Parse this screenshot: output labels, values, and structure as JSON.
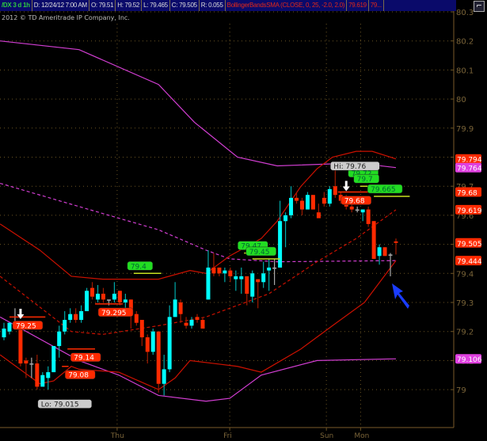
{
  "header": {
    "symbol": "/DX 3 d 1h",
    "date": "D: 12/24/12 7:00 AM",
    "open": "O: 79.51",
    "high": "H: 79.52",
    "low": "L: 79.465",
    "close": "C: 79.505",
    "range": "R: 0.055",
    "study": "BollingerBandsSMA (CLOSE, 0, 25, -2.0, 2.0)",
    "study_value1": "79.619",
    "study_value2": "79..."
  },
  "copyright": "2012 © TD Ameritrade IP Company, Inc.",
  "colors": {
    "up": "#00ffff",
    "down": "#ff2a00",
    "doji": "#aaaaaa",
    "band": "#cc1100",
    "magenta": "#d23ed2",
    "grid": "#6b5423",
    "label_green": "#22dd22",
    "arrow": "#1a3cff"
  },
  "chart_data": {
    "type": "candlestick",
    "title": "/DX 3 d 1h",
    "ylim": [
      79.0,
      80.3
    ],
    "yticks": [
      "80.3",
      "80.2",
      "80.1",
      "80",
      "79.9",
      "79.8",
      "79.7",
      "79.6",
      "79.5",
      "79.4",
      "79.3",
      "79.2",
      "79.1",
      "79"
    ],
    "xticks": [
      {
        "label": "Thu",
        "i": 20.5
      },
      {
        "label": "Fri",
        "i": 40.9
      },
      {
        "label": "Sun",
        "i": 58.4
      },
      {
        "label": "Mon",
        "i": 64.6
      }
    ],
    "candles": [
      [
        79.18,
        79.23,
        79.17,
        79.21
      ],
      [
        79.2,
        79.23,
        79.19,
        79.23
      ],
      [
        79.23,
        79.28,
        79.23,
        79.23
      ],
      [
        79.23,
        79.23,
        79.08,
        79.09
      ],
      [
        79.1,
        79.11,
        79.04,
        79.09
      ],
      [
        79.09,
        79.11,
        79.04,
        79.09
      ],
      [
        79.09,
        79.12,
        79.0,
        79.01
      ],
      [
        79.01,
        79.06,
        79.015,
        79.05
      ],
      [
        79.04,
        79.08,
        79.0,
        79.06
      ],
      [
        79.06,
        79.15,
        79.06,
        79.15
      ],
      [
        79.15,
        79.22,
        79.11,
        79.2
      ],
      [
        79.2,
        79.27,
        79.19,
        79.24
      ],
      [
        79.24,
        79.28,
        79.23,
        79.26
      ],
      [
        79.26,
        79.28,
        79.23,
        79.24
      ],
      [
        79.24,
        79.29,
        79.23,
        79.27
      ],
      [
        79.27,
        79.35,
        79.27,
        79.34
      ],
      [
        79.35,
        79.37,
        79.31,
        79.32
      ],
      [
        79.31,
        79.36,
        79.3,
        79.33
      ],
      [
        79.33,
        79.35,
        79.3,
        79.31
      ],
      [
        79.31,
        79.31,
        79.29,
        79.31
      ],
      [
        79.31,
        79.37,
        79.3,
        79.33
      ],
      [
        79.34,
        79.34,
        79.29,
        79.3
      ],
      [
        79.3,
        79.33,
        79.27,
        79.31
      ],
      [
        79.31,
        79.31,
        79.21,
        79.26
      ],
      [
        79.26,
        79.27,
        79.22,
        79.23
      ],
      [
        79.24,
        79.24,
        79.15,
        79.18
      ],
      [
        79.18,
        79.19,
        79.09,
        79.13
      ],
      [
        79.13,
        79.21,
        79.12,
        79.2
      ],
      [
        79.2,
        79.2,
        78.99,
        79.02
      ],
      [
        79.02,
        79.12,
        78.98,
        79.07
      ],
      [
        79.07,
        79.29,
        79.06,
        79.25
      ],
      [
        79.25,
        79.37,
        79.25,
        79.31
      ],
      [
        79.3,
        79.31,
        79.23,
        79.26
      ],
      [
        79.23,
        79.25,
        79.21,
        79.22
      ],
      [
        79.22,
        79.25,
        79.21,
        79.24
      ],
      [
        79.25,
        79.26,
        79.23,
        79.24
      ],
      [
        79.24,
        79.25,
        79.21,
        79.21
      ],
      [
        79.31,
        79.48,
        79.31,
        79.42
      ],
      [
        79.42,
        79.47,
        79.39,
        79.4
      ],
      [
        79.42,
        79.42,
        79.39,
        79.4
      ],
      [
        79.4,
        79.42,
        79.37,
        79.41
      ],
      [
        79.41,
        79.42,
        79.37,
        79.39
      ],
      [
        79.38,
        79.41,
        79.34,
        79.39
      ],
      [
        79.38,
        79.42,
        79.33,
        79.39
      ],
      [
        79.39,
        79.39,
        79.29,
        79.33
      ],
      [
        79.32,
        79.41,
        79.3,
        79.4
      ],
      [
        79.38,
        79.38,
        79.28,
        79.37
      ],
      [
        79.37,
        79.44,
        79.35,
        79.4
      ],
      [
        79.41,
        79.45,
        79.34,
        79.42
      ],
      [
        79.42,
        79.45,
        79.36,
        79.42
      ],
      [
        79.42,
        79.65,
        79.42,
        79.58
      ],
      [
        79.58,
        79.61,
        79.49,
        79.6
      ],
      [
        79.6,
        79.7,
        79.59,
        79.66
      ],
      [
        79.66,
        79.68,
        79.64,
        79.65
      ],
      [
        79.65,
        79.66,
        79.6,
        79.62
      ],
      [
        79.62,
        79.68,
        79.62,
        79.67
      ],
      [
        79.67,
        79.67,
        79.62,
        79.62
      ],
      [
        79.61,
        79.64,
        79.59,
        79.59
      ],
      [
        79.66,
        79.68,
        79.63,
        79.64
      ],
      [
        79.64,
        79.7,
        79.63,
        79.69
      ],
      [
        79.7,
        79.76,
        79.66,
        79.67
      ],
      [
        79.67,
        79.68,
        79.64,
        79.65
      ],
      [
        79.65,
        79.67,
        79.62,
        79.63
      ],
      [
        79.63,
        79.64,
        79.61,
        79.62
      ],
      [
        79.62,
        79.63,
        79.61,
        79.62
      ],
      [
        79.61,
        79.62,
        79.58,
        79.62
      ],
      [
        79.62,
        79.63,
        79.56,
        79.57
      ],
      [
        79.58,
        79.58,
        79.45,
        79.45
      ],
      [
        79.46,
        79.5,
        79.43,
        79.49
      ],
      [
        79.49,
        79.49,
        79.46,
        79.46
      ],
      [
        79.465,
        79.47,
        79.39,
        79.465
      ],
      [
        79.51,
        79.52,
        79.465,
        79.505
      ]
    ],
    "bands": {
      "upper": [
        [
          -0.7,
          79.57
        ],
        [
          6.5,
          79.48
        ],
        [
          12.2,
          79.39
        ],
        [
          17.9,
          79.38
        ],
        [
          28,
          79.38
        ],
        [
          33.7,
          79.41
        ],
        [
          36.6,
          79.4
        ],
        [
          40.9,
          79.46
        ],
        [
          46.6,
          79.52
        ],
        [
          49.5,
          79.58
        ],
        [
          53.8,
          79.7
        ],
        [
          56.7,
          79.76
        ],
        [
          59.5,
          79.8
        ],
        [
          63.8,
          79.82
        ],
        [
          66.7,
          79.82
        ],
        [
          71,
          79.794
        ]
      ],
      "middle": [
        [
          -0.7,
          79.39
        ],
        [
          12.2,
          79.2
        ],
        [
          17.9,
          79.19
        ],
        [
          28,
          79.22
        ],
        [
          36.6,
          79.25
        ],
        [
          42.3,
          79.29
        ],
        [
          48,
          79.33
        ],
        [
          56.7,
          79.44
        ],
        [
          63.8,
          79.52
        ],
        [
          71,
          79.619
        ]
      ],
      "lower": [
        [
          -0.7,
          79.12
        ],
        [
          6.5,
          79.02
        ],
        [
          9,
          79.03
        ],
        [
          12.2,
          79.08
        ],
        [
          13.6,
          79.07
        ],
        [
          20.8,
          79.06
        ],
        [
          28,
          79.0
        ],
        [
          31,
          79.04
        ],
        [
          33.7,
          79.1
        ],
        [
          38,
          79.09
        ],
        [
          42.3,
          79.08
        ],
        [
          46.6,
          79.06
        ],
        [
          53.8,
          79.14
        ],
        [
          59.5,
          79.22
        ],
        [
          65.3,
          79.3
        ],
        [
          71,
          79.444
        ]
      ],
      "magenta_upper": [
        [
          -0.7,
          80.2
        ],
        [
          13.6,
          80.17
        ],
        [
          28,
          80.05
        ],
        [
          34.5,
          79.92
        ],
        [
          42.3,
          79.8
        ],
        [
          49.5,
          79.77
        ],
        [
          63.8,
          79.78
        ],
        [
          71,
          79.764
        ]
      ],
      "magenta_lower": [
        [
          -0.7,
          79.25
        ],
        [
          13.6,
          79.1
        ],
        [
          20.8,
          79.05
        ],
        [
          28,
          78.98
        ],
        [
          36.6,
          78.96
        ],
        [
          40.9,
          78.97
        ],
        [
          46.6,
          79.05
        ],
        [
          56.7,
          79.1
        ],
        [
          71,
          79.106
        ]
      ],
      "magenta_dashed": [
        [
          -0.7,
          79.71
        ],
        [
          13.6,
          79.63
        ],
        [
          28,
          79.55
        ],
        [
          36.6,
          79.48
        ],
        [
          40.9,
          79.45
        ],
        [
          49.5,
          79.44
        ],
        [
          71,
          79.444
        ]
      ]
    },
    "axis_labels": [
      {
        "text": "79.794",
        "price": 79.794,
        "color": "#ff2a00"
      },
      {
        "text": "79.764",
        "price": 79.764,
        "color": "#e040e0"
      },
      {
        "text": "79.68",
        "price": 79.68,
        "color": "#ff2a00"
      },
      {
        "text": "79.619",
        "price": 79.619,
        "color": "#ff2a00"
      },
      {
        "text": "79.505",
        "price": 79.505,
        "color": "#ff2a00"
      },
      {
        "text": "79.444",
        "price": 79.444,
        "color": "#ff2a00"
      },
      {
        "text": "79.106",
        "price": 79.106,
        "color": "#e040e0"
      }
    ],
    "red_levels": [
      {
        "text": "79.25",
        "price": 79.25,
        "i0": 1,
        "i1": 7.5
      },
      {
        "text": "79.14",
        "price": 79.14,
        "i0": 11.5,
        "i1": 16.5
      },
      {
        "text": "79.08",
        "price": 79.08,
        "i0": 10.5,
        "i1": 11.7
      },
      {
        "text": "79.295",
        "price": 79.295,
        "i0": 16.5,
        "i1": 21.5
      },
      {
        "text": "79.68",
        "price": 79.68,
        "i0": 60.5,
        "i1": 66
      }
    ],
    "green_levels": [
      {
        "text": "79.4",
        "price": 79.4,
        "i0": 23.5,
        "i1": 28.5
      },
      {
        "text": "79.47",
        "price": 79.47,
        "i0": 43.5,
        "i1": 49
      },
      {
        "text": "79.45",
        "price": 79.45,
        "i0": 45,
        "i1": 50
      },
      {
        "text": "79.72",
        "price": 79.72,
        "i0": 63.5,
        "i1": 66
      },
      {
        "text": "79.7",
        "price": 79.7,
        "i0": 64.5,
        "i1": 67
      },
      {
        "text": "79.665",
        "price": 79.665,
        "i0": 67,
        "i1": 73.5
      }
    ],
    "hi": {
      "text": "Hi: 79.76",
      "price": 79.76,
      "i": 60
    },
    "lo": {
      "text": "Lo: 79.015",
      "price": 79.015,
      "i": 7
    },
    "signal_arrows": [
      {
        "i": 3,
        "price": 79.24
      },
      {
        "i": 62,
        "price": 79.68
      }
    ]
  }
}
